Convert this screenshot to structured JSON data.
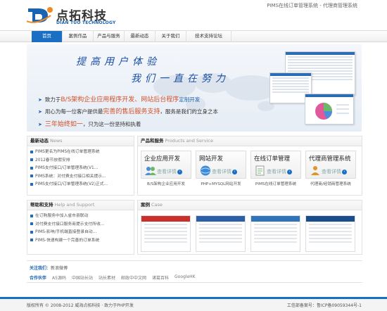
{
  "header": {
    "logo_cn": "点拓科技",
    "logo_en": "DIAN TUO TECHNOLOGY",
    "site_tag": "PIMS在线订单管理系统 - 代理商管理系统"
  },
  "nav": {
    "items": [
      "首页",
      "案例作品",
      "产品与服务",
      "最新动态",
      "关于我们",
      "技术支持论坛"
    ]
  },
  "banner": {
    "slogan1": "提高用户体验",
    "slogan2": "我们一直在努力",
    "line1_pre": "致力于",
    "line1_hl": "B/S架构企业应用程序开发、网站后台程序",
    "line1_post": "定制开发",
    "line2_pre": "用心为每一位客户提供最",
    "line2_hl": "完善的售后服务支持",
    "line2_post": "，服务是我们的立身之本",
    "line3_pre": "三年始终如一",
    "line3_post": "，只为这一份坚持和执着"
  },
  "news": {
    "title": "最新动态",
    "subtitle": "News",
    "items": [
      "PIMS更名为PIMS在线订单管理系统",
      "2012春节放假安排",
      "PIMS支付接口/订单管理系统(V1...",
      "PIMS系统：对付费支付接口相关提示...",
      "PIMS支付接口/订单管理系统(V2)正式..."
    ]
  },
  "help": {
    "title": "帮助和支持",
    "subtitle": "Help and Support",
    "items": [
      "在订购服务中加入省市县联动",
      "对付费支付接口服务商提示支付所收...",
      "PIMS-影响/手机端直接登录自动...",
      "PIMS-快速构建一个完善的订单系统"
    ]
  },
  "products": {
    "title": "产品和服务",
    "subtitle": "Products and Service",
    "more_label": "查看详情",
    "items": [
      {
        "name": "企业应用开发",
        "sub": "B/S架构企业应用开发"
      },
      {
        "name": "网站开发",
        "sub": "PHP+MYSQL网站开发"
      },
      {
        "name": "在线订单管理",
        "sub": "PIMS在线订单管理系统"
      },
      {
        "name": "代理商管理系统",
        "sub": "代理商/经销商管理系统"
      }
    ]
  },
  "cases": {
    "title": "案例",
    "subtitle": "Case"
  },
  "follow": {
    "label": "关注我们",
    "value": "：新浪微博"
  },
  "partners": {
    "label": "合作伙伴",
    "items": [
      "A5源码",
      "中国站长站",
      "站长素材",
      "邮政中中文网",
      "诸葛百科",
      "GoogleHK"
    ]
  },
  "footer": {
    "copyright": "版权所有 © 2008-2012 威海点拓科技 · 致力于PHP开发",
    "icp": "工信部备案号：鲁ICP备09059344号-1"
  },
  "colors": {
    "brand_blue": "#1a6fc4",
    "highlight_orange": "#d4502a"
  }
}
